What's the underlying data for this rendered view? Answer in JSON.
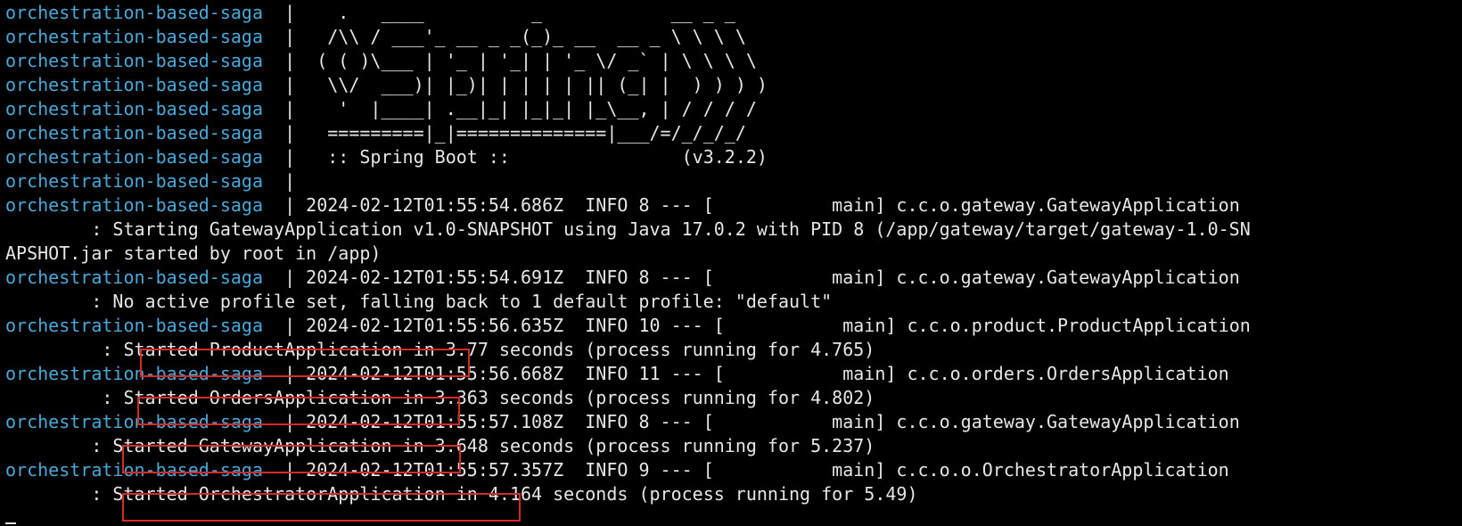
{
  "terminal": {
    "container_prefix": "orchestration-based-saga",
    "separator": "|",
    "banner": [
      "   .   ____          _            __ _ _",
      "  /\\\\ / ___'_ __ _ _(_)_ __  __ _ \\ \\ \\ \\",
      " ( ( )\\___ | '_ | '_| | '_ \\/ _` | \\ \\ \\ \\",
      "  \\\\/  ___)| |_)| | | | | || (_| |  ) ) ) )",
      "   '  |____| .__|_| |_|_| |_\\__, | / / / /",
      "  =========|_|==============|___/=/_/_/_/",
      "  :: Spring Boot ::                (v3.2.2)",
      ""
    ],
    "logs": [
      {
        "head": "2024-02-12T01:55:54.686Z  INFO 8 --- [           main] c.c.o.gateway.GatewayApplication",
        "cont": [
          "        : Starting GatewayApplication v1.0-SNAPSHOT using Java 17.0.2 with PID 8 (/app/gateway/target/gateway-1.0-SN",
          "APSHOT.jar started by root in /app)"
        ]
      },
      {
        "head": "2024-02-12T01:55:54.691Z  INFO 8 --- [           main] c.c.o.gateway.GatewayApplication",
        "cont": [
          "        : No active profile set, falling back to 1 default profile: \"default\""
        ]
      },
      {
        "head": "2024-02-12T01:55:56.635Z  INFO 10 --- [           main] c.c.o.product.ProductApplication",
        "msg_pre": "         : ",
        "msg_started": "Started ProductApplication",
        "msg_post": " in 3.77 seconds (process running for 4.765)"
      },
      {
        "head": "2024-02-12T01:55:56.668Z  INFO 11 --- [           main] c.c.o.orders.OrdersApplication",
        "msg_pre": "         : ",
        "msg_started": "Started OrdersApplication",
        "msg_post": " in 3.363 seconds (process running for 4.802)"
      },
      {
        "head": "2024-02-12T01:55:57.108Z  INFO 8 --- [           main] c.c.o.gateway.GatewayApplication",
        "msg_pre": "        : ",
        "msg_started": "Started GatewayApplication",
        "msg_post": " in 3.648 seconds (process running for 5.237)"
      },
      {
        "head": "2024-02-12T01:55:57.357Z  INFO 9 --- [           main] c.c.o.o.OrchestratorApplication",
        "msg_pre": "        : ",
        "msg_started": "Started OrchestratorApplication",
        "msg_post": " in 4.164 seconds (process running for 5.49)"
      }
    ]
  }
}
